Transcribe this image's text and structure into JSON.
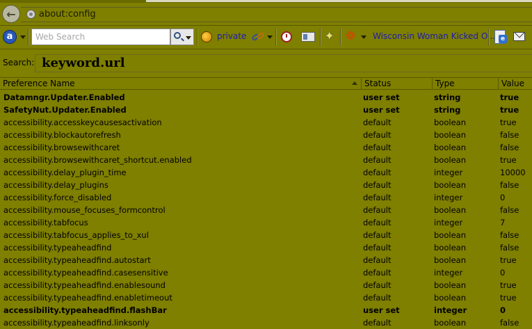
{
  "url_bar": {
    "url": "about:config"
  },
  "toolbar": {
    "search_placeholder": "Web Search",
    "private_label": "private",
    "news_link": "Wisconsin Woman Kicked O..."
  },
  "filter": {
    "label": "Search:",
    "value": "keyword.url"
  },
  "columns": {
    "name": "Preference Name",
    "status": "Status",
    "type": "Type",
    "value": "Value"
  },
  "rows": [
    {
      "name": "Datamngr.Updater.Enabled",
      "status": "user set",
      "type": "string",
      "value": "true"
    },
    {
      "name": "SafetyNut.Updater.Enabled",
      "status": "user set",
      "type": "string",
      "value": "true"
    },
    {
      "name": "accessibility.accesskeycausesactivation",
      "status": "default",
      "type": "boolean",
      "value": "true"
    },
    {
      "name": "accessibility.blockautorefresh",
      "status": "default",
      "type": "boolean",
      "value": "false"
    },
    {
      "name": "accessibility.browsewithcaret",
      "status": "default",
      "type": "boolean",
      "value": "false"
    },
    {
      "name": "accessibility.browsewithcaret_shortcut.enabled",
      "status": "default",
      "type": "boolean",
      "value": "true"
    },
    {
      "name": "accessibility.delay_plugin_time",
      "status": "default",
      "type": "integer",
      "value": "10000"
    },
    {
      "name": "accessibility.delay_plugins",
      "status": "default",
      "type": "boolean",
      "value": "false"
    },
    {
      "name": "accessibility.force_disabled",
      "status": "default",
      "type": "integer",
      "value": "0"
    },
    {
      "name": "accessibility.mouse_focuses_formcontrol",
      "status": "default",
      "type": "boolean",
      "value": "false"
    },
    {
      "name": "accessibility.tabfocus",
      "status": "default",
      "type": "integer",
      "value": "7"
    },
    {
      "name": "accessibility.tabfocus_applies_to_xul",
      "status": "default",
      "type": "boolean",
      "value": "false"
    },
    {
      "name": "accessibility.typeaheadfind",
      "status": "default",
      "type": "boolean",
      "value": "false"
    },
    {
      "name": "accessibility.typeaheadfind.autostart",
      "status": "default",
      "type": "boolean",
      "value": "true"
    },
    {
      "name": "accessibility.typeaheadfind.casesensitive",
      "status": "default",
      "type": "integer",
      "value": "0"
    },
    {
      "name": "accessibility.typeaheadfind.enablesound",
      "status": "default",
      "type": "boolean",
      "value": "true"
    },
    {
      "name": "accessibility.typeaheadfind.enabletimeout",
      "status": "default",
      "type": "boolean",
      "value": "true"
    },
    {
      "name": "accessibility.typeaheadfind.flashBar",
      "status": "user set",
      "type": "integer",
      "value": "0"
    },
    {
      "name": "accessibility.typeaheadfind.linksonly",
      "status": "default",
      "type": "boolean",
      "value": "false"
    }
  ]
}
